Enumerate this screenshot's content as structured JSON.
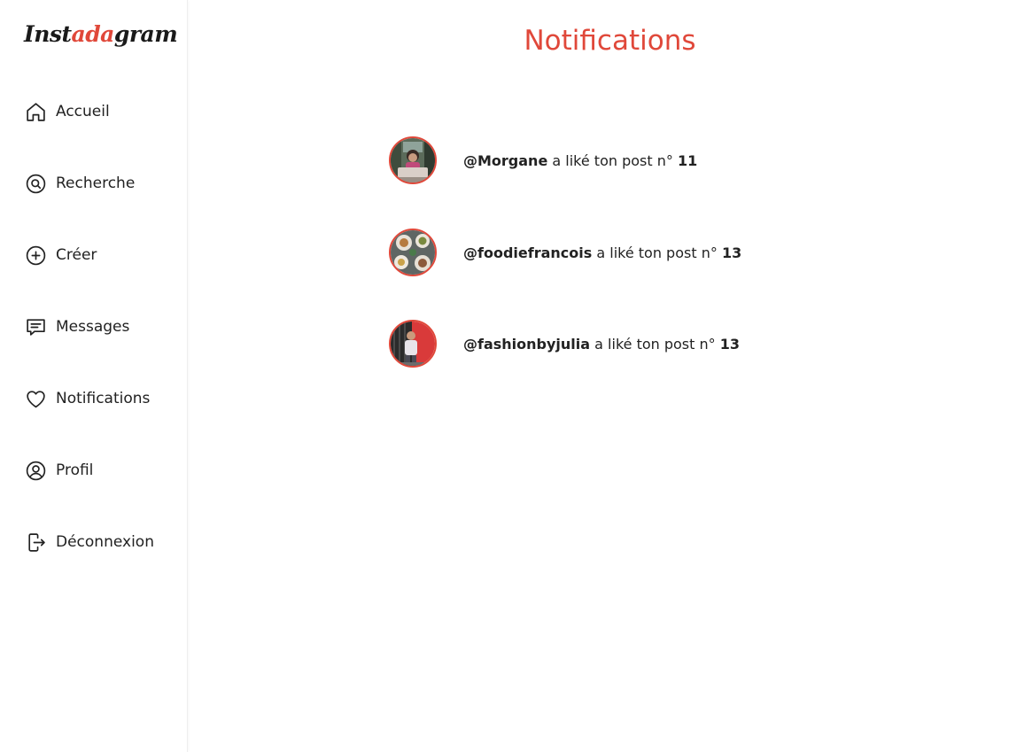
{
  "app": {
    "logo_prefix": "Inst",
    "logo_accent": "ada",
    "logo_suffix": "gram",
    "accent_color": "#e0483a"
  },
  "sidebar": {
    "items": [
      {
        "label": "Accueil",
        "icon": "home-icon"
      },
      {
        "label": "Recherche",
        "icon": "search-icon"
      },
      {
        "label": "Créer",
        "icon": "plus-circle-icon"
      },
      {
        "label": "Messages",
        "icon": "message-icon"
      },
      {
        "label": "Notifications",
        "icon": "heart-icon"
      },
      {
        "label": "Profil",
        "icon": "user-circle-icon"
      },
      {
        "label": "Déconnexion",
        "icon": "logout-icon"
      }
    ]
  },
  "main": {
    "title": "Notifications",
    "notifications": [
      {
        "user": "@Morgane",
        "action": "a liké ton post n°",
        "post": "11"
      },
      {
        "user": "@foodiefrancois",
        "action": "a liké ton post n°",
        "post": "13"
      },
      {
        "user": "@fashionbyjulia",
        "action": "a liké ton post n°",
        "post": "13"
      }
    ]
  }
}
